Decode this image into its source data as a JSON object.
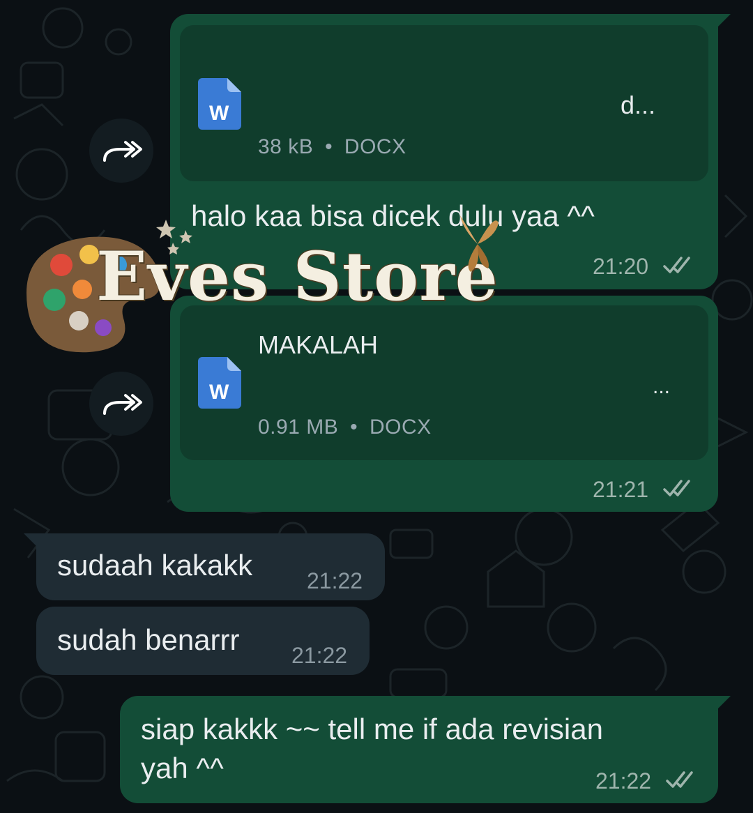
{
  "messages": [
    {
      "doc_title": "d...",
      "doc_size": "38 kB",
      "doc_type": "DOCX",
      "caption": "halo kaa bisa dicek dulu yaa ^^",
      "time": "21:20"
    },
    {
      "doc_title": "MAKALAH",
      "doc_more": "...",
      "doc_size": "0.91 MB",
      "doc_type": "DOCX",
      "time": "21:21"
    },
    {
      "text": "sudaah kakakk",
      "time": "21:22"
    },
    {
      "text": "sudah benarrr",
      "time": "21:22"
    },
    {
      "text_line1": "siap kakkk ~~ tell me if ada revisian",
      "text_line2": "yah ^^",
      "time": "21:22"
    }
  ],
  "doc_icon_letter": "W",
  "meta_separator": "•",
  "watermark": {
    "text": "Eves Store"
  },
  "icons": {
    "document": "word-document-icon",
    "forward": "forward-icon",
    "read": "double-check-icon"
  },
  "colors": {
    "outgoing_bubble": "#134d37",
    "incoming_bubble": "#1f2c34",
    "background": "#0b1014",
    "word_blue": "#3a7bd5",
    "read_ticks": "#9fb5ad"
  }
}
